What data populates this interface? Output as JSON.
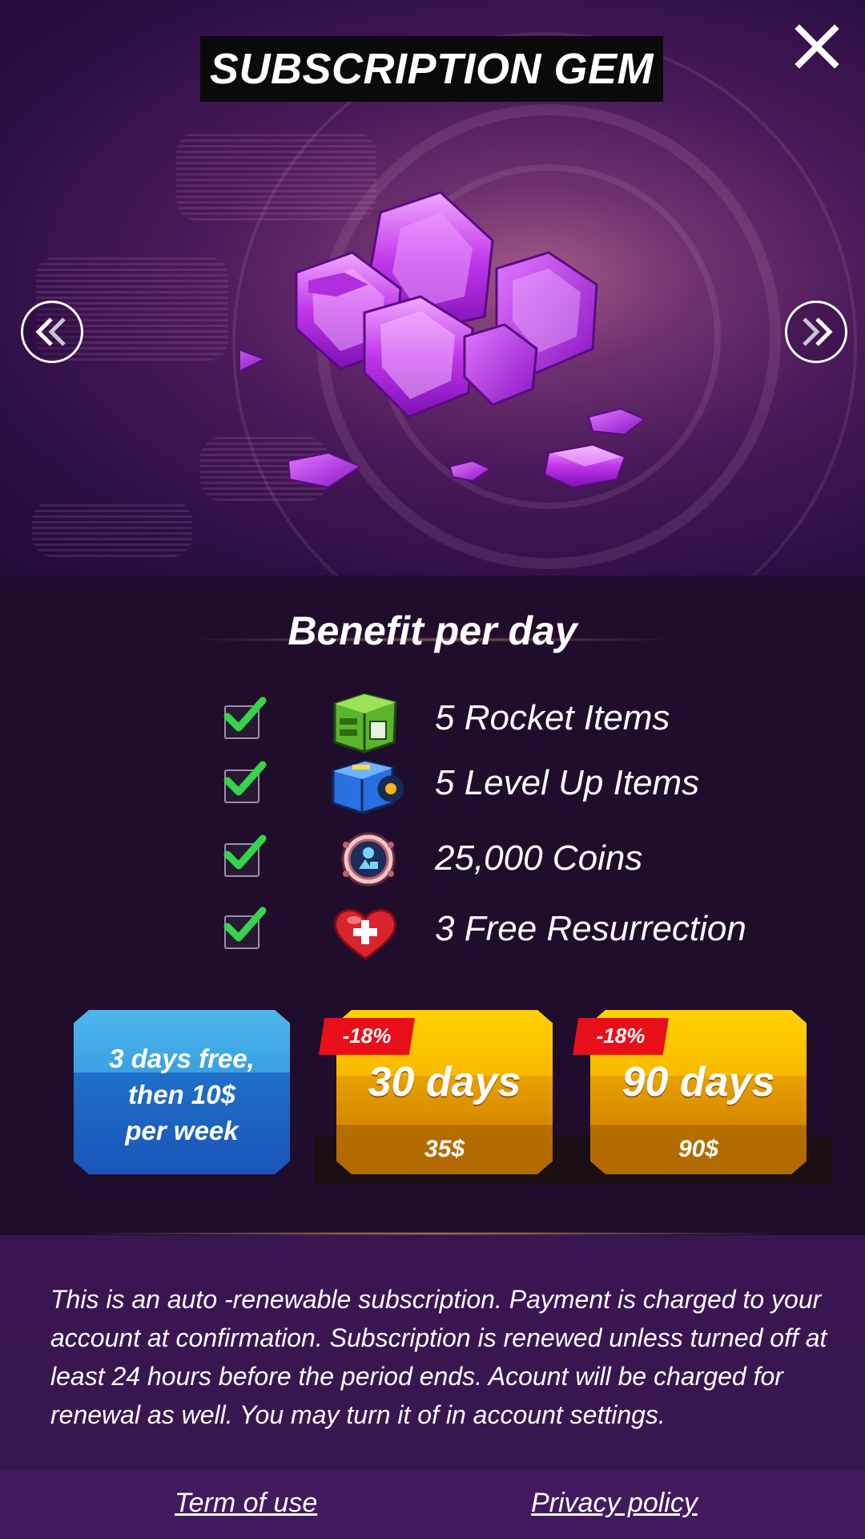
{
  "header": {
    "title": "SUBSCRIPTION GEM",
    "close_icon": "close-icon",
    "prev_icon": "double-chevron-left-icon",
    "next_icon": "double-chevron-right-icon"
  },
  "hero": {
    "image": "purple-gems-illustration"
  },
  "benefits": {
    "title": "Benefit per day",
    "items": [
      {
        "icon": "rocket-crate-icon",
        "label": "5 Rocket Items",
        "checked": true
      },
      {
        "icon": "level-up-chest-icon",
        "label": "5 Level Up Items",
        "checked": true
      },
      {
        "icon": "coin-icon",
        "label": "25,000 Coins",
        "checked": true
      },
      {
        "icon": "heart-plus-icon",
        "label": "3 Free Resurrection",
        "checked": true
      }
    ]
  },
  "plans": [
    {
      "kind": "trial",
      "lines": [
        "3 days free,",
        "then 10$",
        "per week"
      ]
    },
    {
      "kind": "paid",
      "discount": "-18%",
      "duration": "30 days",
      "price": "35$"
    },
    {
      "kind": "paid",
      "discount": "-18%",
      "duration": "90 days",
      "price": "90$"
    }
  ],
  "legal": {
    "text": "This is an auto -renewable subscription. Payment is charged to your account at confirmation. Subscription is renewed unless turned off at least 24 hours before the period ends. Acount will be charged for renewal as well. You may turn it of in account settings."
  },
  "footer": {
    "terms": "Term of use",
    "privacy": "Privacy policy"
  },
  "colors": {
    "background": "#200d2c",
    "trial_button": "#2a86d6",
    "paid_button": "#f4b400",
    "discount_badge": "#e80f18",
    "check": "#33d54a"
  }
}
